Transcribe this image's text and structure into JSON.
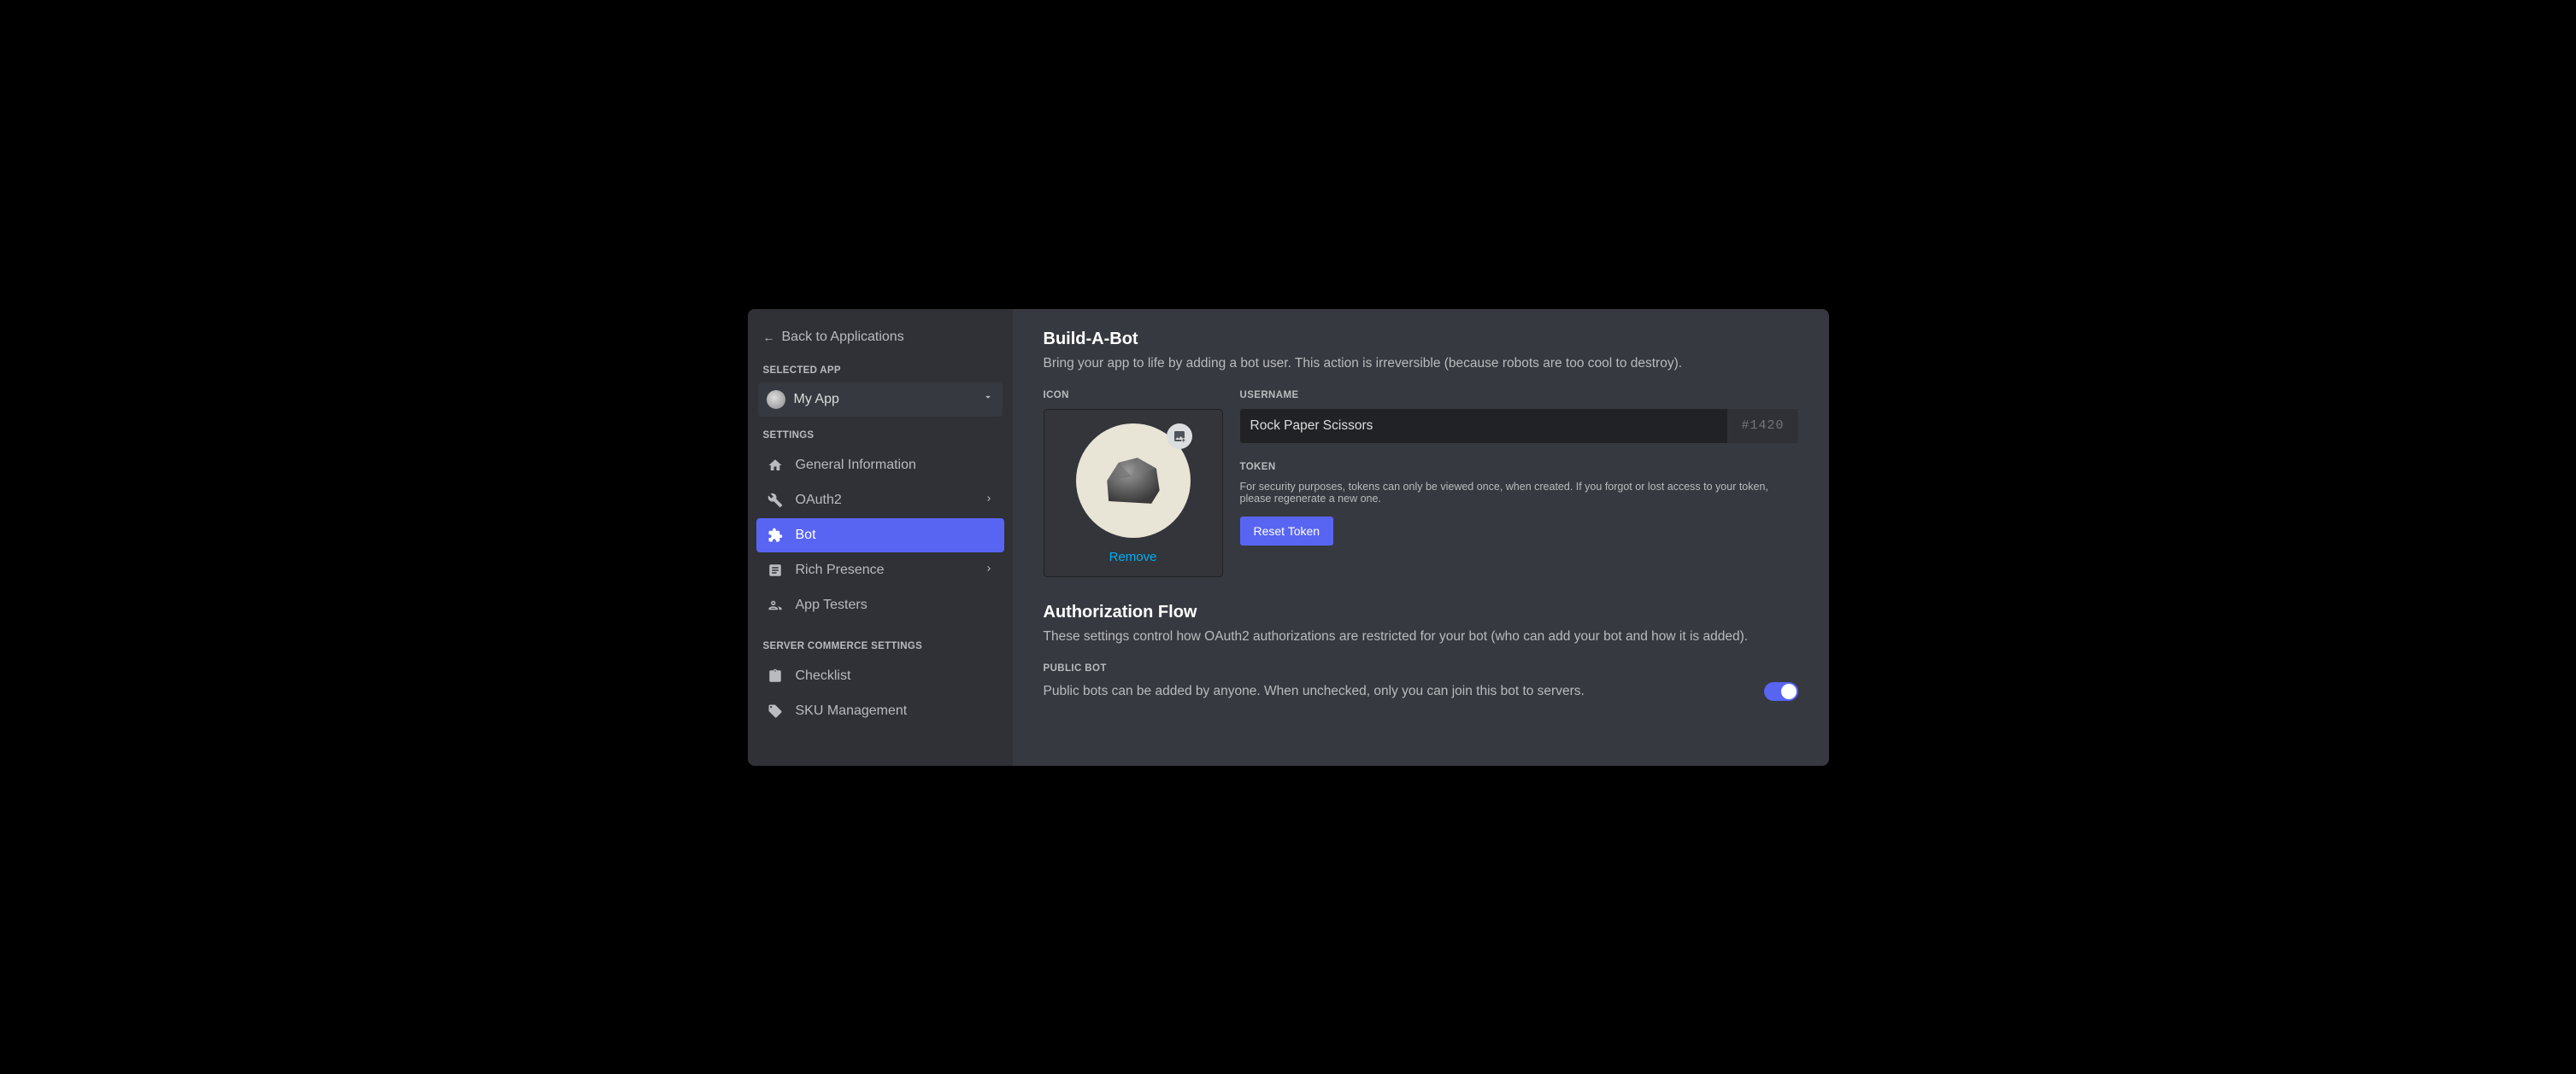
{
  "sidebar": {
    "back_label": "Back to Applications",
    "selected_app_header": "SELECTED APP",
    "app_name": "My App",
    "settings_header": "SETTINGS",
    "items": [
      {
        "key": "general",
        "label": "General Information"
      },
      {
        "key": "oauth2",
        "label": "OAuth2"
      },
      {
        "key": "bot",
        "label": "Bot"
      },
      {
        "key": "rich-presence",
        "label": "Rich Presence"
      },
      {
        "key": "app-testers",
        "label": "App Testers"
      }
    ],
    "commerce_header": "SERVER COMMERCE SETTINGS",
    "commerce_items": [
      {
        "key": "checklist",
        "label": "Checklist"
      },
      {
        "key": "sku",
        "label": "SKU Management"
      }
    ]
  },
  "main": {
    "title": "Build-A-Bot",
    "subtitle": "Bring your app to life by adding a bot user. This action is irreversible (because robots are too cool to destroy).",
    "icon_label": "ICON",
    "remove_label": "Remove",
    "username_label": "USERNAME",
    "username_value": "Rock Paper Scissors",
    "discriminator": "#1420",
    "token_label": "TOKEN",
    "token_note": "For security purposes, tokens can only be viewed once, when created. If you forgot or lost access to your token, please regenerate a new one.",
    "reset_token_label": "Reset Token",
    "auth_title": "Authorization Flow",
    "auth_subtitle": "These settings control how OAuth2 authorizations are restricted for your bot (who can add your bot and how it is added).",
    "public_bot_label": "PUBLIC BOT",
    "public_bot_desc": "Public bots can be added by anyone. When unchecked, only you can join this bot to servers.",
    "public_bot_enabled": true
  }
}
